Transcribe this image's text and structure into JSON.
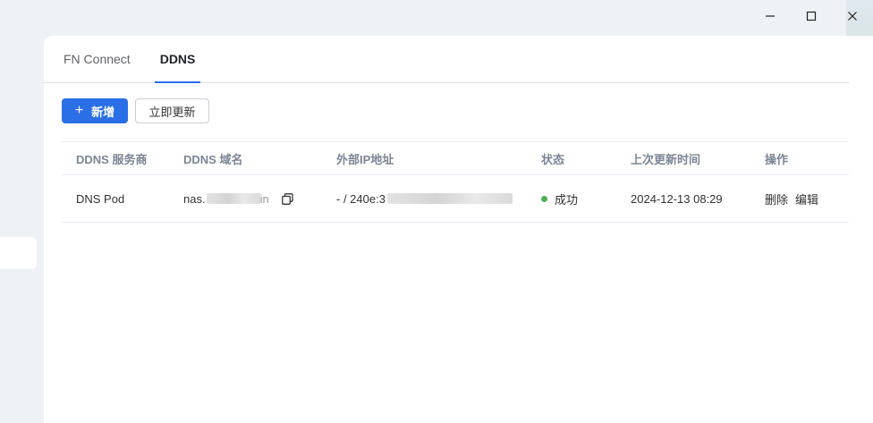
{
  "window": {
    "tabs": [
      {
        "label": "FN Connect",
        "active": false
      },
      {
        "label": "DDNS",
        "active": true
      }
    ]
  },
  "toolbar": {
    "add_label": "新增",
    "update_label": "立即更新"
  },
  "table": {
    "headers": [
      "DDNS 服务商",
      "DDNS 域名",
      "外部IP地址",
      "状态",
      "上次更新时间",
      "操作"
    ],
    "rows": [
      {
        "provider": "DNS Pod",
        "domain_prefix": "nas.",
        "domain_suffix": "in",
        "ip_prefix": "- / 240e:3",
        "status": "成功",
        "status_color": "#4caf50",
        "updated": "2024-12-13 08:29",
        "actions": {
          "delete": "删除",
          "edit": "编辑"
        }
      }
    ]
  },
  "colors": {
    "primary": "#2a6fe6",
    "tab_indicator": "#2b6ee8"
  }
}
